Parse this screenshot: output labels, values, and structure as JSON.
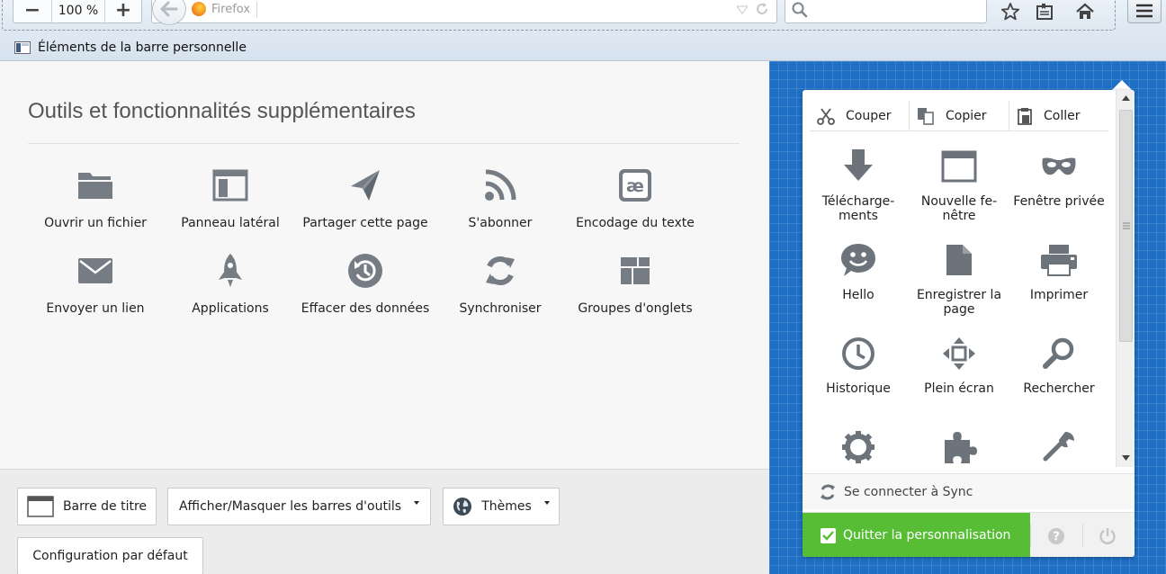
{
  "toolbar": {
    "zoom_out": "−",
    "zoom_level": "100 %",
    "zoom_in": "+",
    "identity_label": "Firefox",
    "url_value": "",
    "search_value": "",
    "search_placeholder": ""
  },
  "bookmarks": {
    "label": "Éléments de la barre personnelle"
  },
  "palette": {
    "title": "Outils et fonctionnalités supplémentaires",
    "items": [
      {
        "label": "Ouvrir un fichier"
      },
      {
        "label": "Panneau latéral"
      },
      {
        "label": "Partager cette page"
      },
      {
        "label": "S'abonner"
      },
      {
        "label": "Encodage du texte"
      },
      {
        "label": "Envoyer un lien"
      },
      {
        "label": "Applications"
      },
      {
        "label": "Effacer des données"
      },
      {
        "label": "Synchroniser"
      },
      {
        "label": "Groupes d'onglets"
      }
    ]
  },
  "footer": {
    "titlebar_label": "Barre de titre",
    "toolbars_label": "Afficher/Masquer les barres d'outils",
    "themes_label": "Thèmes",
    "restore_label": "Configuration par défaut"
  },
  "panel": {
    "edit": {
      "cut": "Couper",
      "copy": "Copier",
      "paste": "Coller"
    },
    "items": [
      {
        "label": "Télécharge-\nments"
      },
      {
        "label": "Nouvelle fe-\nnêtre"
      },
      {
        "label": "Fenêtre privée"
      },
      {
        "label": "Hello"
      },
      {
        "label": "Enregistrer la page"
      },
      {
        "label": "Imprimer"
      },
      {
        "label": "Historique"
      },
      {
        "label": "Plein écran"
      },
      {
        "label": "Rechercher"
      }
    ],
    "sync_label": "Se connecter à Sync",
    "quit_label": "Quitter la personnalisation"
  },
  "colors": {
    "icon_gray": "#6c757d",
    "blueprint": "#1f6fc4",
    "quit_green": "#57bd35"
  }
}
